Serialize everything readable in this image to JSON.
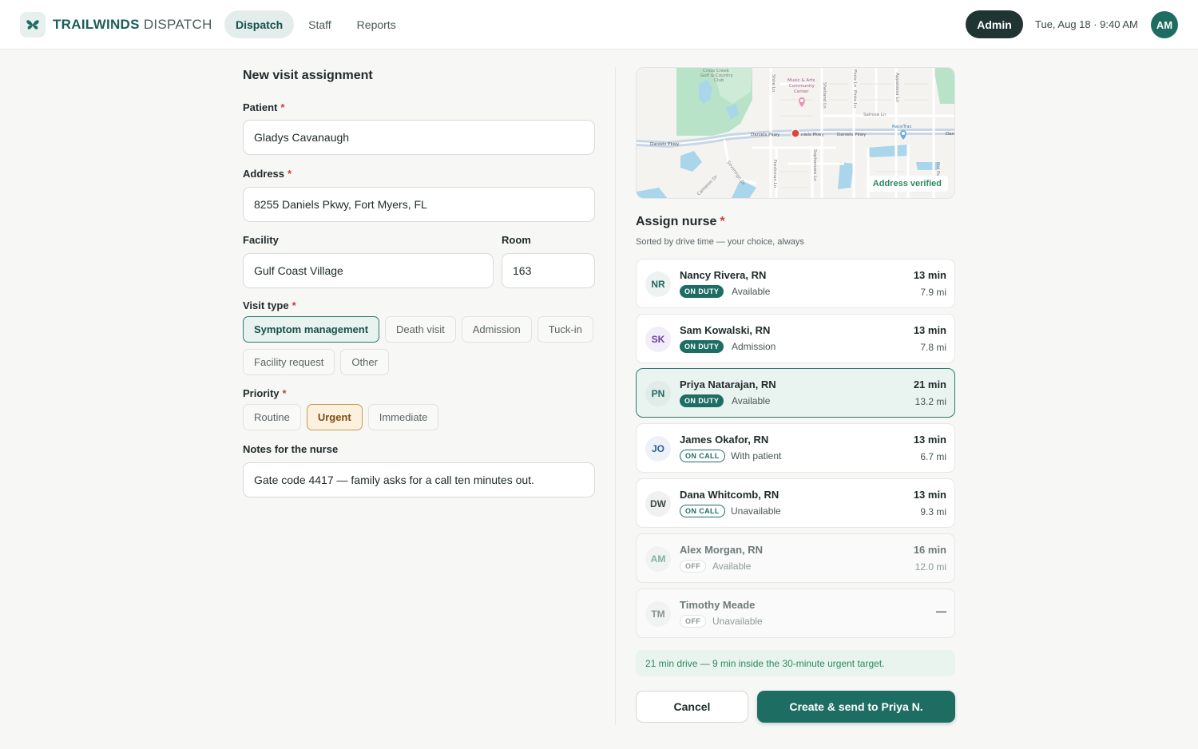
{
  "header": {
    "brand_primary": "TRAILWINDS",
    "brand_secondary": "DISPATCH",
    "tabs": [
      {
        "label": "Dispatch",
        "active": true
      },
      {
        "label": "Staff",
        "active": false
      },
      {
        "label": "Reports",
        "active": false
      }
    ],
    "role": "Admin",
    "datetime": "Tue, Aug 18 · 9:40 AM",
    "user_initials": "AM"
  },
  "form": {
    "title": "New visit assignment",
    "patient": {
      "label": "Patient",
      "value": "Gladys Cavanaugh"
    },
    "address": {
      "label": "Address",
      "value": "8255 Daniels Pkwy, Fort Myers, FL"
    },
    "facility": {
      "label": "Facility",
      "value": "Gulf Coast Village"
    },
    "room": {
      "label": "Room",
      "value": "163"
    },
    "visit_type": {
      "label": "Visit type",
      "options": [
        "Symptom management",
        "Death visit",
        "Admission",
        "Tuck-in",
        "Facility request",
        "Other"
      ],
      "selected": "Symptom management"
    },
    "priority": {
      "label": "Priority",
      "options": [
        "Routine",
        "Urgent",
        "Immediate"
      ],
      "selected": "Urgent"
    },
    "notes": {
      "label": "Notes for the nurse",
      "value": "Gate code 4417 — family asks for a call ten minutes out."
    }
  },
  "map": {
    "labels": {
      "golf": [
        "Cross Creek",
        "Golf & Country",
        "Club"
      ],
      "center": [
        "Music & Arts",
        "Community",
        "Center"
      ],
      "daniels_left": "Daniels Pkwy",
      "daniels_mid": "Daniels Pkwy",
      "daniels_mid2": "niels Pkwy",
      "daniels_right": "Daniels Pkwy",
      "dan": "Dan",
      "salrose": "Salrose Ln",
      "racetrac": "RaceTrac",
      "shire": "Shire Ln",
      "shetland": "Shetland Ln",
      "pinto": "Pinto Ln",
      "pinto2": "Pinto Ln",
      "appaloosa": "Appaloosa Ln",
      "freshman": "Freshman Ln",
      "sophomore": "Sophomore Ln",
      "sovereign": "Sovereign Dr",
      "cameron": "Cameron Dr",
      "oldfa": "Old Fa"
    },
    "verified": "Address verified"
  },
  "assign": {
    "title": "Assign nurse",
    "subtitle": "Sorted by drive time — your choice, always",
    "nurses": [
      {
        "initials": "NR",
        "name": "Nancy Rivera, RN",
        "badge": "ON DUTY",
        "badge_kind": "duty",
        "status": "Available",
        "drive": "13 min",
        "distance": "7.9 mi",
        "initials_color": "#1f6a5f"
      },
      {
        "initials": "SK",
        "name": "Sam Kowalski, RN",
        "badge": "ON DUTY",
        "badge_kind": "duty",
        "status": "Admission",
        "drive": "13 min",
        "distance": "7.8 mi",
        "initials_color": "#6a3fa6"
      },
      {
        "initials": "PN",
        "name": "Priya Natarajan, RN",
        "badge": "ON DUTY",
        "badge_kind": "duty",
        "status": "Available",
        "drive": "21 min",
        "distance": "13.2 mi",
        "initials_color": "#1f6a5f"
      },
      {
        "initials": "JO",
        "name": "James Okafor, RN",
        "badge": "ON CALL",
        "badge_kind": "call",
        "status": "With patient",
        "drive": "13 min",
        "distance": "6.7 mi",
        "initials_color": "#2c5f9e"
      },
      {
        "initials": "DW",
        "name": "Dana Whitcomb, RN",
        "badge": "ON CALL",
        "badge_kind": "call",
        "status": "Unavailable",
        "drive": "13 min",
        "distance": "9.3 mi",
        "initials_color": "#3e4949"
      },
      {
        "initials": "AM",
        "name": "Alex Morgan, RN",
        "badge": "OFF",
        "badge_kind": "off",
        "status": "Available",
        "drive": "16 min",
        "distance": "12.0 mi",
        "initials_color": "#7fb3a6"
      },
      {
        "initials": "TM",
        "name": "Timothy Meade",
        "badge": "OFF",
        "badge_kind": "off",
        "status": "Unavailable",
        "drive": "—",
        "distance": "",
        "initials_color": "#8a9494"
      }
    ],
    "selected_index": 2,
    "summary": "21 min drive — 9 min inside the 30-minute urgent target."
  },
  "actions": {
    "cancel": "Cancel",
    "create": "Create & send to Priya N."
  },
  "colors": {
    "brand": "#1e6d63",
    "required": "#c8413a",
    "urgent_accent": "#c79c4a",
    "success_text": "#2b8a5f"
  }
}
